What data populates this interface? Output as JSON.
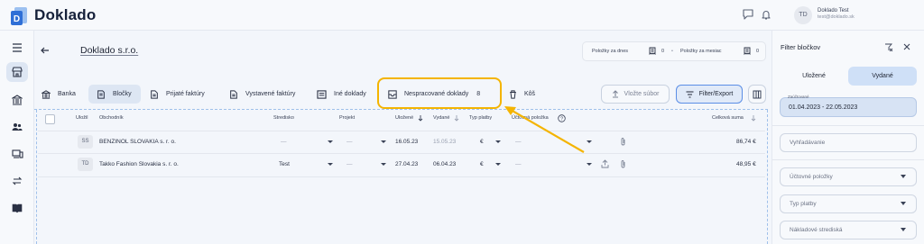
{
  "app": {
    "title": "Doklado"
  },
  "user": {
    "initials": "TD",
    "name": "Doklado Test",
    "email": "test@doklado.sk"
  },
  "page": {
    "company": "Doklado s.r.o."
  },
  "counters": {
    "today_label": "Položky za dnes",
    "today_value": "0",
    "month_label": "Položky za mesiac",
    "month_value": "0"
  },
  "tabs": [
    {
      "label": "Banka"
    },
    {
      "label": "Bločky"
    },
    {
      "label": "Prijaté faktúry"
    },
    {
      "label": "Vystavené faktúry"
    },
    {
      "label": "Iné doklady"
    },
    {
      "label": "Nespracované doklady",
      "count": "8"
    },
    {
      "label": "Kôš"
    }
  ],
  "actions": {
    "upload": "Vložte súbor",
    "filter": "Filter/Export"
  },
  "table": {
    "headers": {
      "created": "Uložil",
      "merchant": "Obchodník",
      "center": "Stredisko",
      "project": "Projekt",
      "saved": "Uložené",
      "issued": "Vydané",
      "payment": "Typ platby",
      "account": "Účtovná položka",
      "total": "Celková suma"
    },
    "rows": [
      {
        "initials": "SS",
        "merchant": "BENZINOL SLOVAKIA s. r. o.",
        "center": "—",
        "project": "—",
        "saved": "16.05.23",
        "issued": "15.05.23",
        "payment": "€",
        "account": "—",
        "total": "86,74 €"
      },
      {
        "initials": "TD",
        "merchant": "Takko Fashion Slovakia s. r. o.",
        "center": "Test",
        "project": "—",
        "saved": "27.04.23",
        "issued": "06.04.23",
        "payment": "€",
        "account": "—",
        "total": "48,95 €"
      }
    ]
  },
  "filter_panel": {
    "title": "Filter bločkov",
    "tabs": [
      {
        "label": "Uložené"
      },
      {
        "label": "Vydané"
      }
    ],
    "date_label": "Zaúčtované",
    "date_value": "01.04.2023 - 22.05.2023",
    "search_placeholder": "Vyhľadávanie",
    "fields": [
      {
        "label": "Účtovné položky"
      },
      {
        "label": "Typ platby"
      },
      {
        "label": "Nákladové strediská"
      }
    ]
  },
  "colors": {
    "accent": "#5b8ee6",
    "highlight": "#f4b400",
    "logo": "#2f6fd6"
  }
}
